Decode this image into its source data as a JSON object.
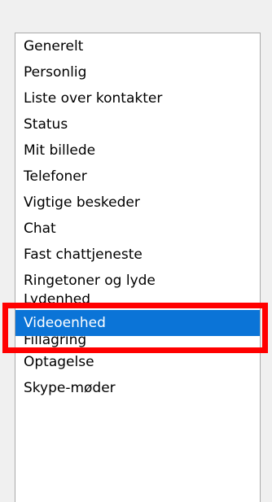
{
  "options_list": {
    "items": [
      {
        "label": "Generelt",
        "selected": false
      },
      {
        "label": "Personlig",
        "selected": false
      },
      {
        "label": "Liste over kontakter",
        "selected": false
      },
      {
        "label": "Status",
        "selected": false
      },
      {
        "label": "Mit billede",
        "selected": false
      },
      {
        "label": "Telefoner",
        "selected": false
      },
      {
        "label": "Vigtige beskeder",
        "selected": false
      },
      {
        "label": "Chat",
        "selected": false
      },
      {
        "label": "Fast chattjeneste",
        "selected": false
      },
      {
        "label": "Ringetoner og lyde",
        "selected": false
      },
      {
        "label": "Lydenhed",
        "selected": false
      },
      {
        "label": "Videoenhed",
        "selected": true
      },
      {
        "label": "Fillagring",
        "selected": false
      },
      {
        "label": "Optagelse",
        "selected": false
      },
      {
        "label": "Skype-møder",
        "selected": false
      }
    ]
  },
  "colors": {
    "selection_background": "#0b74d7",
    "highlight_border": "#ff0000"
  }
}
